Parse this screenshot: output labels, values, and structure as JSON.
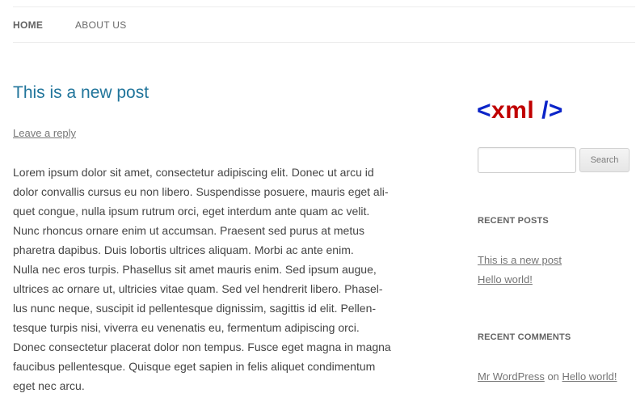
{
  "nav": {
    "items": [
      {
        "label": "HOME",
        "active": true
      },
      {
        "label": "ABOUT US",
        "active": false
      }
    ]
  },
  "post": {
    "title": "This is a new post",
    "reply_link": "Leave a reply",
    "body_lines": [
      "Lorem ipsum dolor sit amet, consectetur adipiscing elit. Donec ut arcu id",
      "dolor convallis cursus eu non libero. Suspendisse posuere, mauris eget ali-",
      "quet congue, nulla ipsum rutrum orci, eget interdum ante quam ac velit.",
      "Nunc rhoncus ornare enim ut accumsan. Praesent sed purus at metus",
      "pharetra dapibus. Duis lobortis ultrices aliquam. Morbi ac ante enim.",
      "Nulla nec eros turpis. Phasellus sit amet mauris enim. Sed ipsum augue,",
      "ultrices ac ornare ut, ultricies vitae quam. Sed vel hendrerit libero. Phasel-",
      "lus nunc neque, suscipit id pellentesque dignissim, sagittis id elit. Pellen-",
      "tesque turpis nisi, viverra eu venenatis eu, fermentum adipiscing orci.",
      "Donec consectetur placerat dolor non tempus. Fusce eget magna in magna",
      "faucibus pellentesque. Quisque eget sapien in felis aliquet condimentum",
      "eget nec arcu."
    ]
  },
  "sidebar": {
    "logo": {
      "open": "<",
      "text": "xml",
      "close": "/>"
    },
    "search": {
      "value": "",
      "button_label": "Search"
    },
    "recent_posts": {
      "title": "RECENT POSTS",
      "items": [
        "This is a new post",
        "Hello world!"
      ]
    },
    "recent_comments": {
      "title": "RECENT COMMENTS",
      "author": "Mr WordPress",
      "connector": "on",
      "post": "Hello world!"
    }
  },
  "colors": {
    "link_blue": "#21759b",
    "logo_bracket": "#0b24c8",
    "logo_text": "#c00000"
  }
}
